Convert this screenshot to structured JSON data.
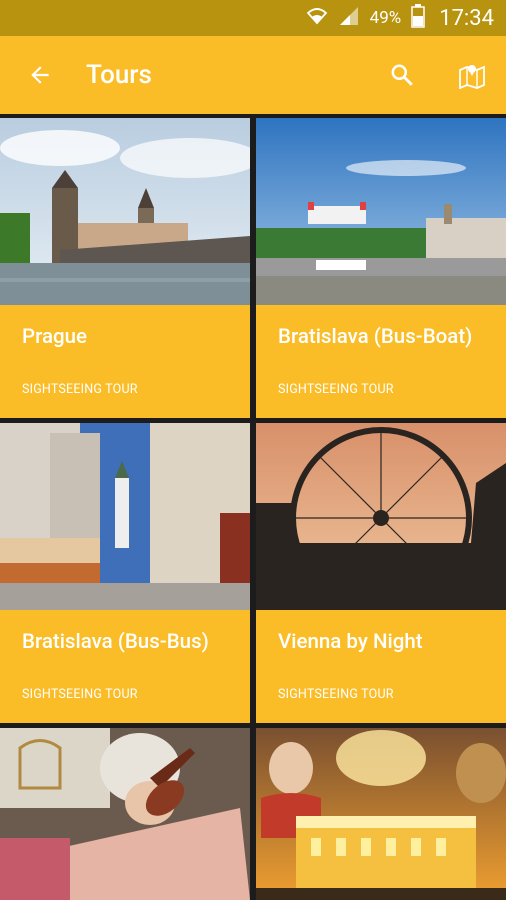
{
  "status_bar": {
    "battery_percent": "49%",
    "time": "17:34"
  },
  "app_bar": {
    "title": "Tours",
    "icons": [
      "back-arrow-icon",
      "search-icon",
      "map-icon"
    ]
  },
  "tours": [
    {
      "name": "Prague",
      "type": "SIGHTSEEING TOUR"
    },
    {
      "name": "Bratislava (Bus-Boat)",
      "type": "SIGHTSEEING TOUR"
    },
    {
      "name": "Bratislava (Bus-Bus)",
      "type": "SIGHTSEEING TOUR"
    },
    {
      "name": "Vienna by Night",
      "type": "SIGHTSEEING TOUR"
    },
    {
      "name": "",
      "type": ""
    },
    {
      "name": "",
      "type": ""
    }
  ],
  "colors": {
    "accent": "#fbbd27",
    "status_bar": "#b8930f",
    "grid_background": "#1c1c1c"
  }
}
